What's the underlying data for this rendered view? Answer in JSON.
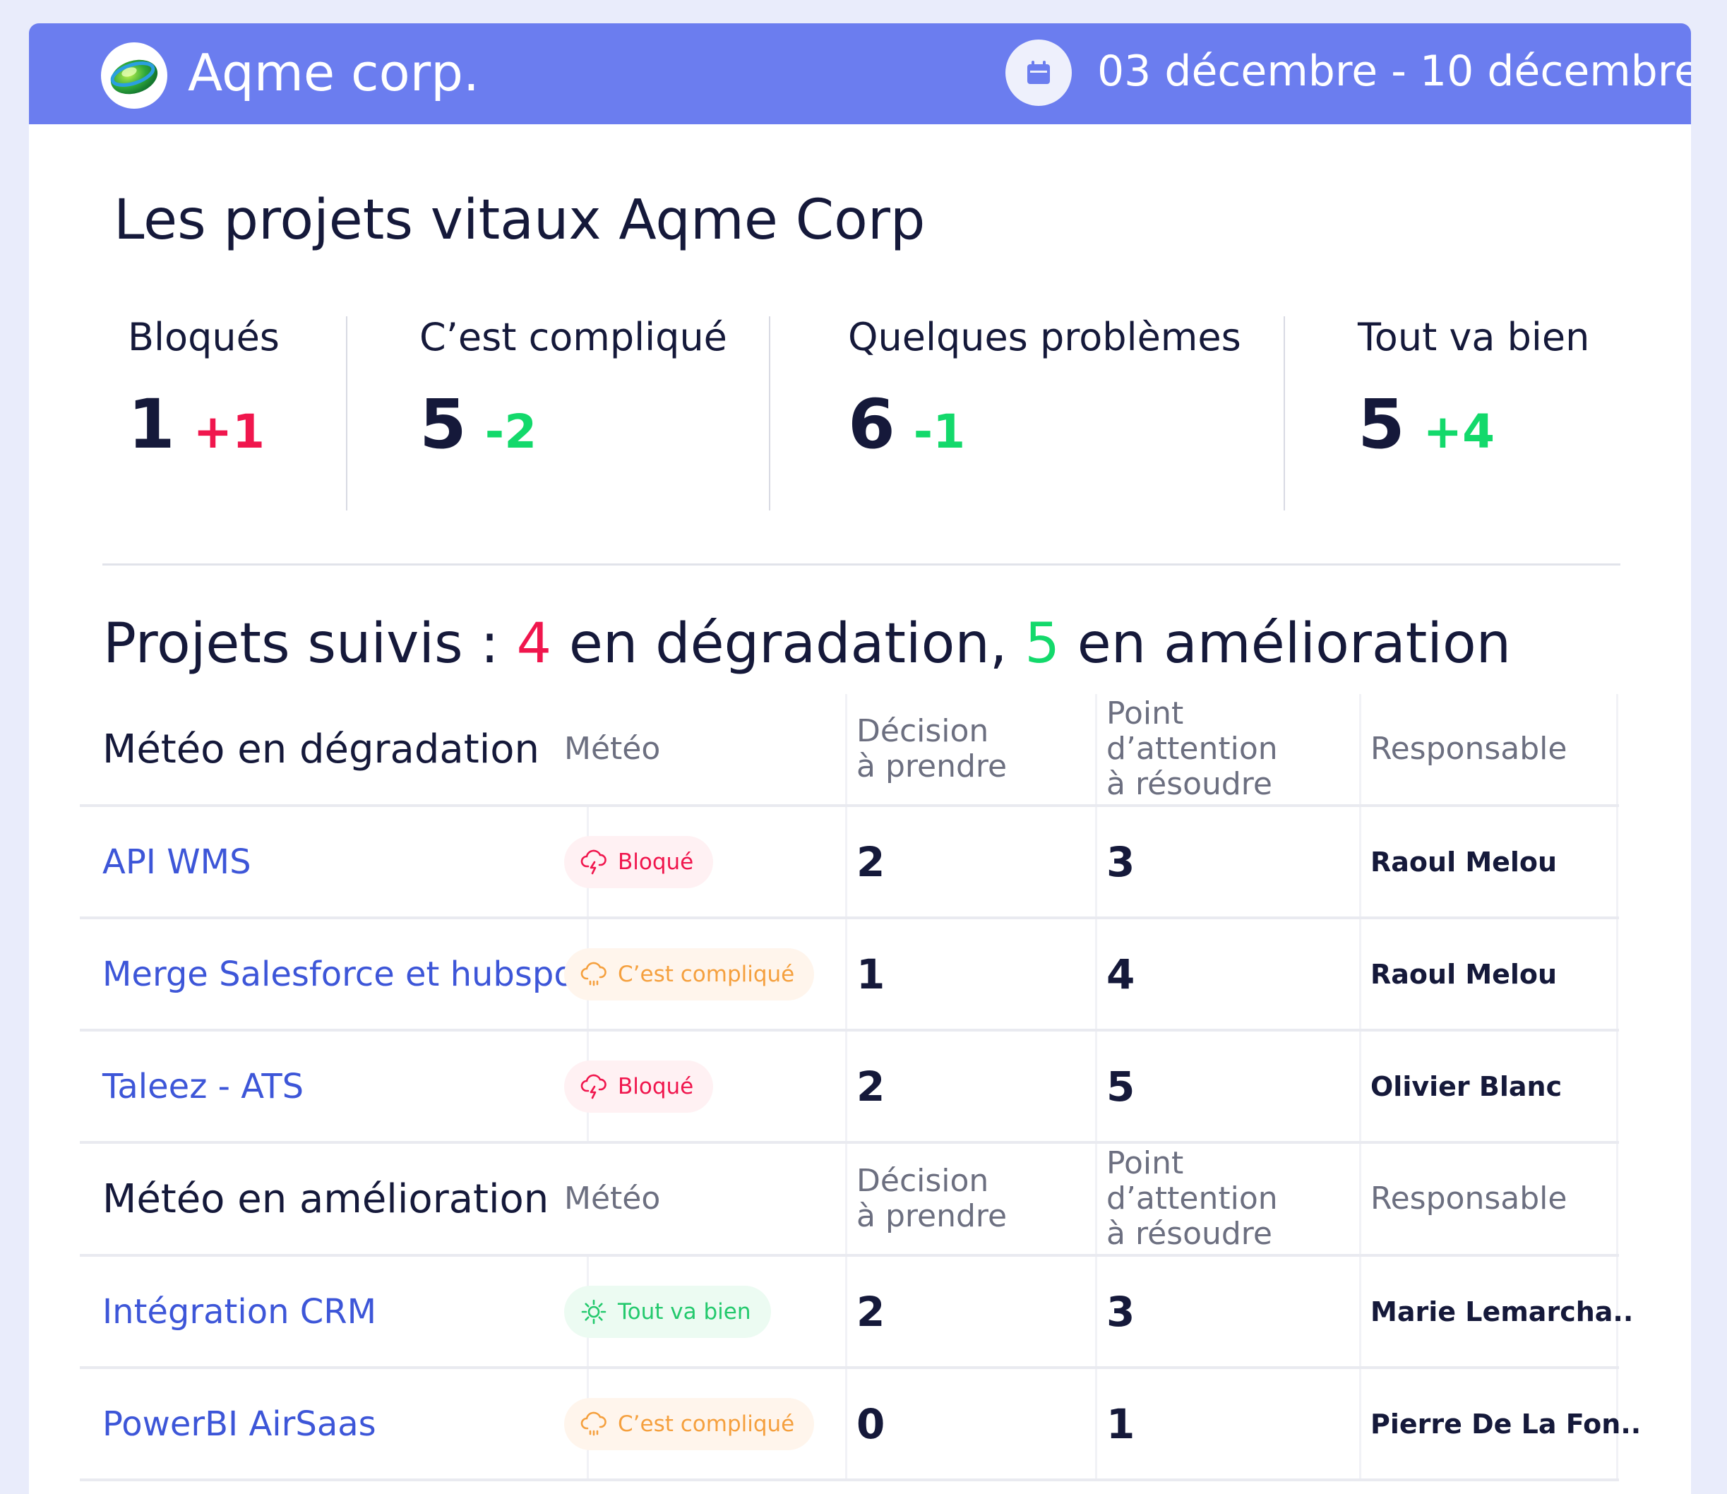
{
  "header": {
    "company": "Aqme corp.",
    "date_range": "03 décembre - 10 décembre",
    "logo_icon": "company-logo",
    "calendar_icon": "calendar-icon",
    "bar_color": "#6b7def"
  },
  "page_title": "Les projets vitaux Aqme Corp",
  "stats": [
    {
      "label": "Bloqués",
      "value": "1",
      "delta": "+1",
      "delta_color": "#f0164d"
    },
    {
      "label": "C’est compliqué",
      "value": "5",
      "delta": "-2",
      "delta_color": "#13d96b"
    },
    {
      "label": "Quelques problèmes",
      "value": "6",
      "delta": "-1",
      "delta_color": "#13d96b"
    },
    {
      "label": "Tout va bien",
      "value": "5",
      "delta": "+4",
      "delta_color": "#13d96b"
    }
  ],
  "followed": {
    "prefix": "Projets suivis : ",
    "degrading_count": "4",
    "degrading_text": " en dégradation, ",
    "improving_count": "5",
    "improving_text": " en amélioration"
  },
  "columns": {
    "weather": "Météo",
    "decision": [
      "Décision",
      "à prendre"
    ],
    "attention": [
      "Point",
      "d’attention",
      "à résoudre"
    ],
    "owner": "Responsable"
  },
  "degrading": {
    "title": "Météo en dégradation",
    "rows": [
      {
        "project": "API WMS",
        "weather": "Bloqué",
        "decisions": "2",
        "points": "3",
        "owner": "Raoul Melou"
      },
      {
        "project": "Merge Salesforce et hubspot",
        "weather": "C’est compliqué",
        "decisions": "1",
        "points": "4",
        "owner": "Raoul Melou"
      },
      {
        "project": "Taleez - ATS",
        "weather": "Bloqué",
        "decisions": "2",
        "points": "5",
        "owner": "Olivier Blanc"
      }
    ]
  },
  "improving": {
    "title": "Météo en amélioration",
    "rows": [
      {
        "project": "Intégration CRM",
        "weather": "Tout va bien",
        "decisions": "2",
        "points": "3",
        "owner": "Marie Lemarcha.."
      },
      {
        "project": "PowerBI AirSaas",
        "weather": "C’est compliqué",
        "decisions": "0",
        "points": "1",
        "owner": "Pierre De La Fon.."
      }
    ]
  },
  "weather_colors": {
    "blocked": "#f0164d",
    "complicated": "#f5a03e",
    "good": "#23c96d"
  }
}
